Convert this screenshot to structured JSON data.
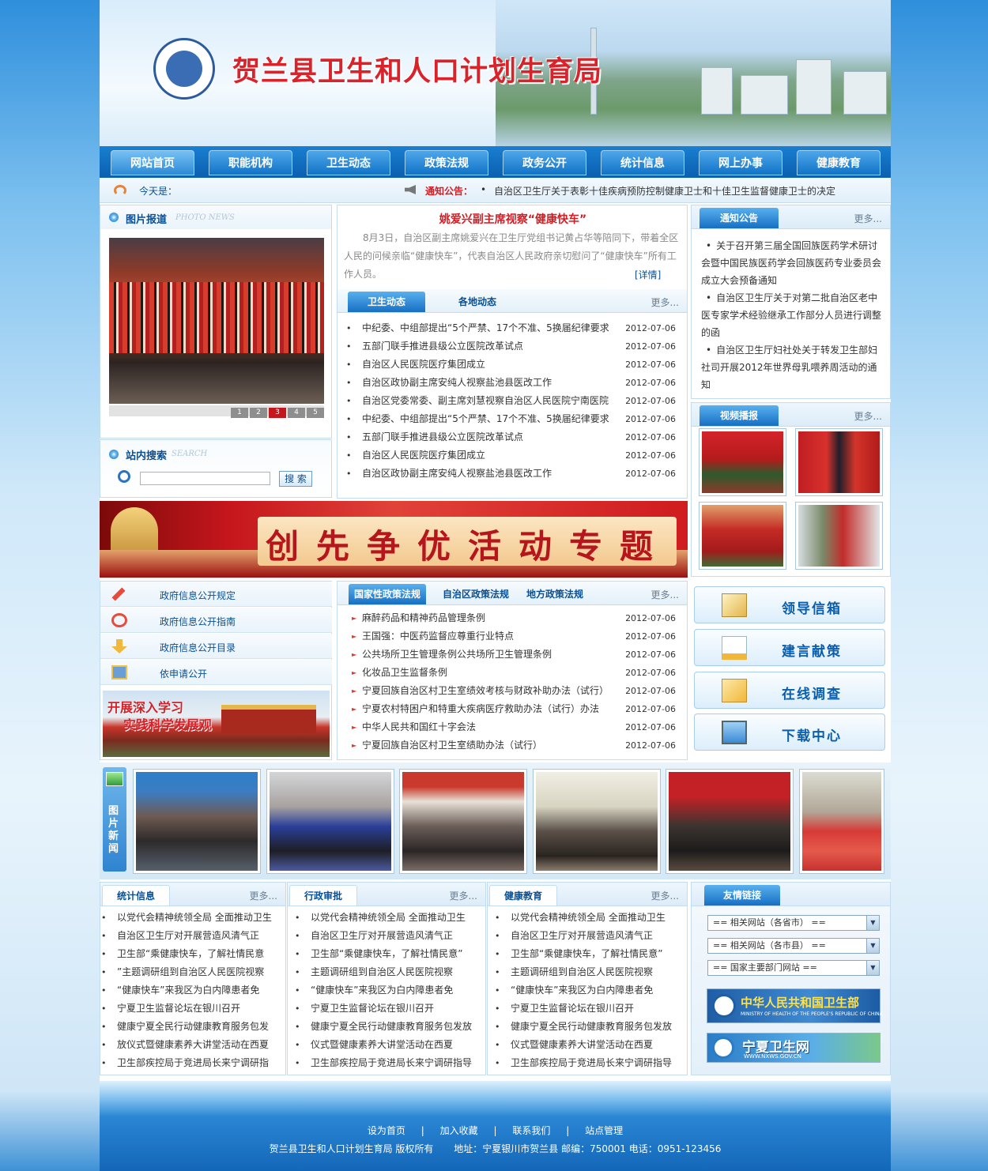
{
  "header": {
    "title": "贺兰县卫生和人口计划生育局"
  },
  "nav": [
    "网站首页",
    "职能机构",
    "卫生动态",
    "政策法规",
    "政务公开",
    "统计信息",
    "网上办事",
    "健康教育"
  ],
  "datebar": {
    "today_label": "今天是：",
    "notice_label": "通知公告：",
    "notice_text": "自治区卫生厅关于表彰十佳疾病预防控制健康卫士和十佳卫生监督健康卫士的决定"
  },
  "photo_news": {
    "title": "图片报道",
    "title_en": "PHOTO NEWS",
    "pages": [
      "1",
      "2",
      "3",
      "4",
      "5"
    ],
    "active_page": 3
  },
  "search": {
    "title": "站内搜索",
    "title_en": "SEARCH",
    "button": "搜 索",
    "value": ""
  },
  "headline": {
    "title": "姚爱兴副主席视察“健康快车”",
    "summary": "8月3日，自治区副主席姚爱兴在卫生厅党组书记黄占华等陪同下，带着全区人民的问候亲临“健康快车”，代表自治区人民政府亲切慰问了“健康快车”所有工作人员。",
    "detail": "[详情]"
  },
  "news_tabs": {
    "tabs": [
      "卫生动态",
      "各地动态"
    ],
    "more": "更多..."
  },
  "news_list": [
    {
      "title": "中纪委、中组部提出“5个严禁、17个不准、5换届纪律要求",
      "date": "2012-07-06"
    },
    {
      "title": "五部门联手推进县级公立医院改革试点",
      "date": "2012-07-06"
    },
    {
      "title": "自治区人民医院医疗集团成立",
      "date": "2012-07-06"
    },
    {
      "title": "自治区政协副主席安纯人视察盐池县医改工作",
      "date": "2012-07-06"
    },
    {
      "title": "自治区党委常委、副主席刘慧视察自治区人民医院宁南医院",
      "date": "2012-07-06"
    },
    {
      "title": "中纪委、中组部提出“5个严禁、17个不准、5换届纪律要求",
      "date": "2012-07-06"
    },
    {
      "title": "五部门联手推进县级公立医院改革试点",
      "date": "2012-07-06"
    },
    {
      "title": "自治区人民医院医疗集团成立",
      "date": "2012-07-06"
    },
    {
      "title": "自治区政协副主席安纯人视察盐池县医改工作",
      "date": "2012-07-06"
    }
  ],
  "notice": {
    "title": "通知公告",
    "more": "更多...",
    "items": [
      "关于召开第三届全国回族医药学术研讨会暨中国民族医药学会回族医药专业委员会成立大会预备通知",
      "自治区卫生厅关于对第二批自治区老中医专家学术经验继承工作部分人员进行调整的函",
      "自治区卫生厅妇社处关于转发卫生部妇社司开展2012年世界母乳喂养周活动的通知"
    ]
  },
  "video": {
    "title": "视频播报",
    "more": "更多..."
  },
  "banner": {
    "text": "创先争优活动专题"
  },
  "info_links": [
    "政府信息公开规定",
    "政府信息公开指南",
    "政府信息公开目录",
    "依申请公开"
  ],
  "study_banner": {
    "line1": "开展深入学习",
    "line2": "实践科学发展观"
  },
  "policy": {
    "tabs": [
      "国家性政策法规",
      "自治区政策法规",
      "地方政策法规"
    ],
    "more": "更多...",
    "items": [
      {
        "title": "麻醉药品和精神药品管理条例",
        "date": "2012-07-06"
      },
      {
        "title": "王国强：中医药监督应尊重行业特点",
        "date": "2012-07-06"
      },
      {
        "title": "公共场所卫生管理条例公共场所卫生管理条例",
        "date": "2012-07-06"
      },
      {
        "title": "化妆品卫生监督条例",
        "date": "2012-07-06"
      },
      {
        "title": "宁夏回族自治区村卫生室绩效考核与财政补助办法（试行）",
        "date": "2012-07-06"
      },
      {
        "title": "宁夏农村特困户和特重大疾病医疗救助办法（试行）办法",
        "date": "2012-07-06"
      },
      {
        "title": "中华人民共和国红十字会法",
        "date": "2012-07-06"
      },
      {
        "title": "宁夏回族自治区村卫生室绩助办法（试行）",
        "date": "2012-07-06"
      }
    ]
  },
  "quick": [
    "领导信箱",
    "建言献策",
    "在线调查",
    "下载中心"
  ],
  "picnews": {
    "label": "图片新闻"
  },
  "col_lists": [
    {
      "title": "统计信息",
      "more": "更多..."
    },
    {
      "title": "行政审批",
      "more": "更多..."
    },
    {
      "title": "健康教育",
      "more": "更多..."
    }
  ],
  "col_items": [
    "以党代会精神统领全局 全面推动卫生",
    "自治区卫生厅对开展营造风清气正",
    "卫生部“乘健康快车，了解社情民意",
    "”主题调研组到自治区人民医院视察",
    "“健康快车”来我区为白内障患者免",
    "宁夏卫生监督论坛在银川召开",
    "健康宁夏全民行动健康教育服务包发",
    "放仪式暨健康素养大讲堂活动在西夏",
    "卫生部疾控局于竞进局长来宁调研指"
  ],
  "col_items_b": [
    "以党代会精神统领全局 全面推动卫生",
    "自治区卫生厅对开展营造风清气正",
    "卫生部“乘健康快车，了解社情民意”",
    "主题调研组到自治区人民医院视察",
    "“健康快车”来我区为白内障患者免",
    "宁夏卫生监督论坛在银川召开",
    "健康宁夏全民行动健康教育服务包发放",
    "仪式暨健康素养大讲堂活动在西夏",
    "卫生部疾控局于竞进局长来宁调研指导"
  ],
  "links": {
    "title": "友情链接",
    "selects": [
      "==  相关网站（各省市） ==",
      "==  相关网站（各市县） ==",
      "==  国家主要部门网站  =="
    ],
    "logo1": "中华人民共和国卫生部",
    "logo1_en": "MINISTRY OF HEALTH OF THE PEOPLE'S REPUBLIC OF CHINA",
    "logo2": "宁夏卫生网",
    "logo2_en": "WWW.NXWS.GOV.CN"
  },
  "footer": {
    "links": [
      "设为首页",
      "加入收藏",
      "联系我们",
      "站点管理"
    ],
    "sep": "|",
    "copyright": "贺兰县卫生和人口计划生育局 版权所有",
    "address": "地址：宁夏银川市贺兰县 邮编：750001 电话：0951-123456"
  }
}
